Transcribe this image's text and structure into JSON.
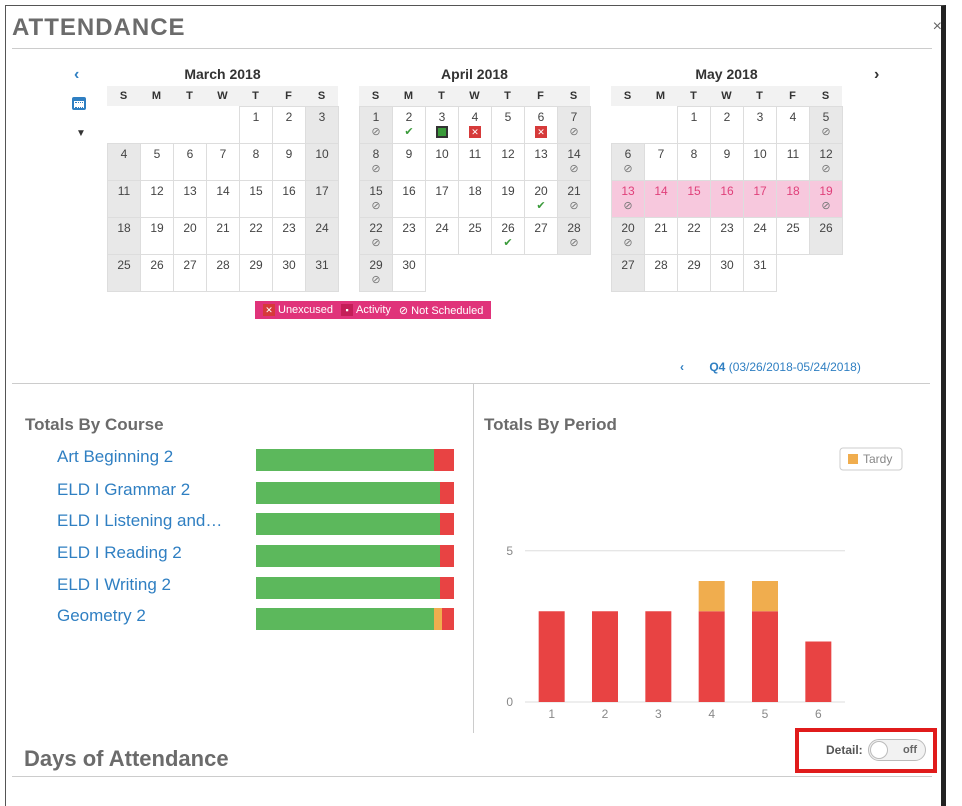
{
  "page": {
    "title": "ATTENDANCE",
    "close_icon": "close-icon"
  },
  "calendar": {
    "prev_icon": "chevron-left-icon",
    "next_icon": "chevron-right-icon",
    "calendar_icon": "calendar-icon",
    "months": [
      {
        "name": "March 2018",
        "dow": [
          "S",
          "M",
          "T",
          "W",
          "T",
          "F",
          "S"
        ],
        "lead_blanks": 4,
        "days": [
          {
            "d": "1"
          },
          {
            "d": "2"
          },
          {
            "d": "3",
            "weekend": true
          },
          {
            "d": "4",
            "weekend": true
          },
          {
            "d": "5"
          },
          {
            "d": "6"
          },
          {
            "d": "7"
          },
          {
            "d": "8"
          },
          {
            "d": "9"
          },
          {
            "d": "10",
            "weekend": true
          },
          {
            "d": "11",
            "weekend": true
          },
          {
            "d": "12"
          },
          {
            "d": "13"
          },
          {
            "d": "14"
          },
          {
            "d": "15"
          },
          {
            "d": "16"
          },
          {
            "d": "17",
            "weekend": true
          },
          {
            "d": "18",
            "weekend": true
          },
          {
            "d": "19"
          },
          {
            "d": "20"
          },
          {
            "d": "21"
          },
          {
            "d": "22"
          },
          {
            "d": "23"
          },
          {
            "d": "24",
            "weekend": true
          },
          {
            "d": "25",
            "weekend": true
          },
          {
            "d": "26"
          },
          {
            "d": "27"
          },
          {
            "d": "28"
          },
          {
            "d": "29"
          },
          {
            "d": "30"
          },
          {
            "d": "31",
            "weekend": true
          }
        ]
      },
      {
        "name": "April 2018",
        "dow": [
          "S",
          "M",
          "T",
          "W",
          "T",
          "F",
          "S"
        ],
        "lead_blanks": 0,
        "days": [
          {
            "d": "1",
            "weekend": true,
            "m": "ns"
          },
          {
            "d": "2",
            "m": "ok"
          },
          {
            "d": "3",
            "m": "act"
          },
          {
            "d": "4",
            "m": "unx"
          },
          {
            "d": "5"
          },
          {
            "d": "6",
            "m": "unx"
          },
          {
            "d": "7",
            "weekend": true,
            "m": "ns"
          },
          {
            "d": "8",
            "weekend": true,
            "m": "ns"
          },
          {
            "d": "9"
          },
          {
            "d": "10"
          },
          {
            "d": "11"
          },
          {
            "d": "12"
          },
          {
            "d": "13"
          },
          {
            "d": "14",
            "weekend": true,
            "m": "ns"
          },
          {
            "d": "15",
            "weekend": true,
            "m": "ns"
          },
          {
            "d": "16"
          },
          {
            "d": "17"
          },
          {
            "d": "18"
          },
          {
            "d": "19"
          },
          {
            "d": "20",
            "m": "ok"
          },
          {
            "d": "21",
            "weekend": true,
            "m": "ns"
          },
          {
            "d": "22",
            "weekend": true,
            "m": "ns"
          },
          {
            "d": "23"
          },
          {
            "d": "24"
          },
          {
            "d": "25"
          },
          {
            "d": "26",
            "m": "ok"
          },
          {
            "d": "27"
          },
          {
            "d": "28",
            "weekend": true,
            "m": "ns"
          },
          {
            "d": "29",
            "weekend": true,
            "m": "ns"
          },
          {
            "d": "30"
          }
        ]
      },
      {
        "name": "May 2018",
        "dow": [
          "S",
          "M",
          "T",
          "W",
          "T",
          "F",
          "S"
        ],
        "lead_blanks": 2,
        "days": [
          {
            "d": "1"
          },
          {
            "d": "2"
          },
          {
            "d": "3"
          },
          {
            "d": "4"
          },
          {
            "d": "5",
            "weekend": true,
            "m": "ns"
          },
          {
            "d": "6",
            "weekend": true,
            "m": "ns"
          },
          {
            "d": "7"
          },
          {
            "d": "8"
          },
          {
            "d": "9"
          },
          {
            "d": "10"
          },
          {
            "d": "11"
          },
          {
            "d": "12",
            "weekend": true,
            "m": "ns"
          },
          {
            "d": "13",
            "pink": true,
            "m": "ns"
          },
          {
            "d": "14",
            "pink": true
          },
          {
            "d": "15",
            "pink": true
          },
          {
            "d": "16",
            "pink": true
          },
          {
            "d": "17",
            "pink": true
          },
          {
            "d": "18",
            "pink": true
          },
          {
            "d": "19",
            "pink": true,
            "m": "ns"
          },
          {
            "d": "20",
            "weekend": true,
            "m": "ns"
          },
          {
            "d": "21"
          },
          {
            "d": "22"
          },
          {
            "d": "23"
          },
          {
            "d": "24"
          },
          {
            "d": "25"
          },
          {
            "d": "26",
            "weekend": true
          },
          {
            "d": "27",
            "weekend": true
          },
          {
            "d": "28"
          },
          {
            "d": "29"
          },
          {
            "d": "30"
          },
          {
            "d": "31"
          }
        ]
      }
    ],
    "legend": [
      {
        "label": "Unexcused",
        "kind": "unx"
      },
      {
        "label": "Activity",
        "kind": "act"
      },
      {
        "label": "Not Scheduled",
        "kind": "ns"
      }
    ]
  },
  "quarter": {
    "name": "Q4",
    "range": "(03/26/2018-05/24/2018)"
  },
  "totals_course": {
    "title": "Totals By Course",
    "courses": [
      {
        "name": "Art Beginning 2",
        "green": 0.9,
        "red": 0.1,
        "orange": 0
      },
      {
        "name": "ELD I Grammar 2",
        "green": 0.93,
        "red": 0.07,
        "orange": 0
      },
      {
        "name": "ELD I Listening and…",
        "green": 0.93,
        "red": 0.07,
        "orange": 0
      },
      {
        "name": "ELD I Reading 2",
        "green": 0.93,
        "red": 0.07,
        "orange": 0
      },
      {
        "name": "ELD I Writing 2",
        "green": 0.93,
        "red": 0.07,
        "orange": 0
      },
      {
        "name": "Geometry 2",
        "green": 0.9,
        "red": 0.06,
        "orange": 0.04
      }
    ]
  },
  "totals_period": {
    "title": "Totals By Period"
  },
  "chart_data": {
    "type": "bar",
    "categories": [
      "1",
      "2",
      "3",
      "4",
      "5",
      "6"
    ],
    "series": [
      {
        "name": "Unexcused",
        "color": "#e84343",
        "values": [
          3,
          3,
          3,
          3,
          3,
          2
        ]
      },
      {
        "name": "Tardy",
        "color": "#f0ad4e",
        "values": [
          0,
          0,
          0,
          1,
          1,
          0
        ]
      }
    ],
    "yticks": [
      "0",
      "5"
    ],
    "ylim": [
      0,
      8
    ],
    "legend": [
      "Tardy"
    ]
  },
  "days": {
    "title": "Days of Attendance",
    "detail_label": "Detail:",
    "toggle_label": "off"
  }
}
